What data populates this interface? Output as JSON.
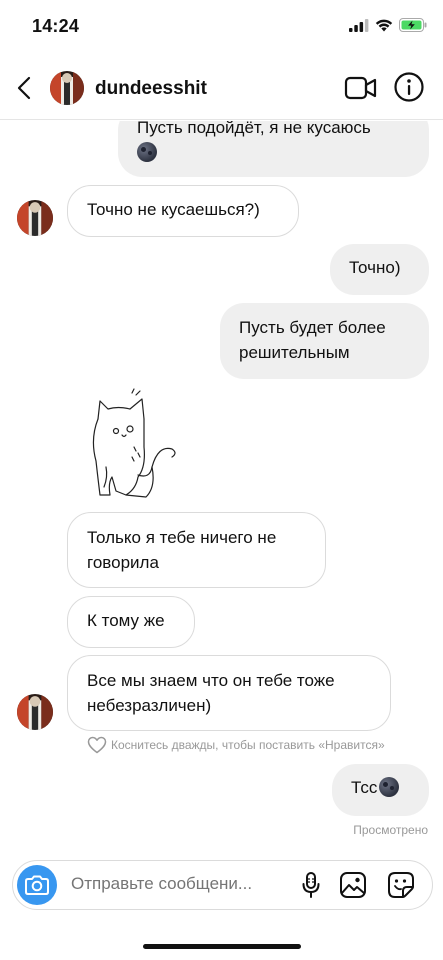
{
  "status_bar": {
    "time": "14:24"
  },
  "header": {
    "username": "dundeesshit"
  },
  "messages": [
    {
      "direction": "out",
      "text": "Пусть подойдёт, я не кусаюсь",
      "emoji": "new-moon-face"
    },
    {
      "direction": "in",
      "text": "Точно не кусаешься?)"
    },
    {
      "direction": "out",
      "text": "Точно)"
    },
    {
      "direction": "out",
      "line1": "Пусть будет более",
      "line2": "решительным"
    },
    {
      "direction": "in",
      "type": "sticker",
      "sticker": "cat-sticker"
    },
    {
      "direction": "in",
      "line1": "Только я тебе ничего не",
      "line2": "говорила"
    },
    {
      "direction": "in",
      "text": "К тому же"
    },
    {
      "direction": "in",
      "line1": "Все мы знаем что он тебе тоже",
      "line2": "небезразличен)"
    },
    {
      "direction": "out",
      "text": "Тсс",
      "emoji": "new-moon-face"
    }
  ],
  "like_hint": "Коснитесь дважды, чтобы поставить «Нравится»",
  "seen_label": "Просмотрено",
  "composer": {
    "placeholder": "Отправьте сообщени..."
  },
  "colors": {
    "accent": "#3897f0",
    "incoming_bubble": "#ffffff",
    "outgoing_bubble": "#efefef"
  }
}
